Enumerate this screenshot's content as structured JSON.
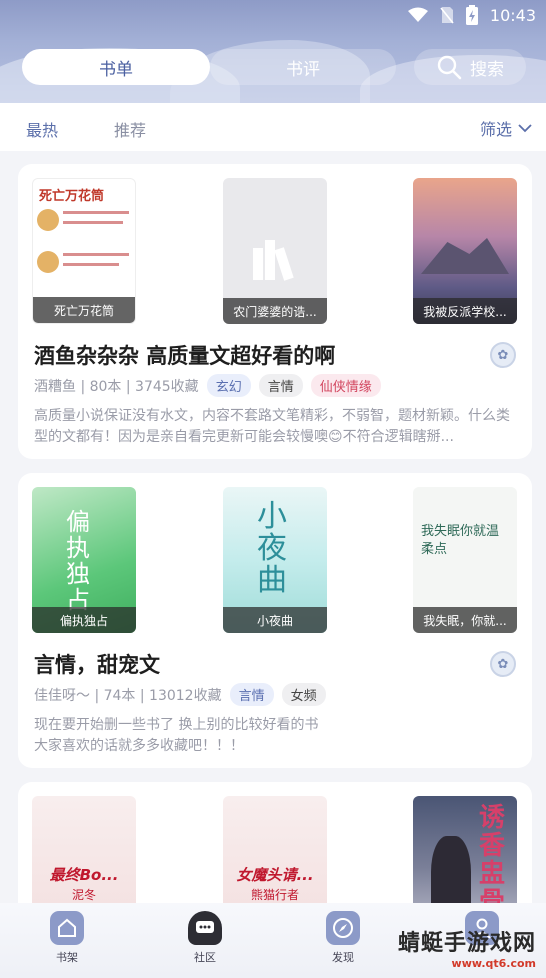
{
  "status": {
    "time": "10:43"
  },
  "top_tabs": [
    "书单",
    "书评"
  ],
  "search": {
    "label": "搜索"
  },
  "filter_tabs": {
    "active": "最热",
    "inactive": "推荐"
  },
  "filter": {
    "label": "筛选"
  },
  "cards": [
    {
      "covers": [
        {
          "caption": "死亡万花筒",
          "cover_text": "死亡万花筒"
        },
        {
          "caption": "农门婆婆的诰..."
        },
        {
          "caption": "我被反派学校..."
        }
      ],
      "title": "酒鱼杂杂杂 高质量文超好看的啊",
      "meta": "酒糟鱼 | 80本 | 3745收藏",
      "tags": [
        "玄幻",
        "言情",
        "仙侠情缘"
      ],
      "desc": "高质量小说保证没有水文，内容不套路文笔精彩，不弱智，题材新颖。什么类型的文都有！因为是亲自看完更新可能会较慢噢😊不符合逻辑瞎掰..."
    },
    {
      "covers": [
        {
          "caption": "偏执独占",
          "cover_text": "偏执独占"
        },
        {
          "caption": "小夜曲",
          "cover_text": "小夜曲"
        },
        {
          "caption": "我失眠，你就...",
          "cover_text": "我失眠你就温柔点"
        }
      ],
      "title": "言情，甜宠文",
      "meta": "佳佳呀～ | 74本 | 13012收藏",
      "tags": [
        "言情",
        "女频"
      ],
      "desc": "现在要开始删一些书了 换上别的比较好看的书\n大家喜欢的话就多多收藏吧！！！"
    },
    {
      "covers": [
        {
          "cover_text": "最终Bo...",
          "author": "泥冬"
        },
        {
          "cover_text": "女魔头请...",
          "author": "熊猫行者"
        },
        {
          "cover_text": "诱香盅骨"
        }
      ]
    }
  ],
  "bottom_nav": [
    "书架",
    "社区",
    "发现"
  ],
  "watermark": {
    "name": "蜻蜓手游戏网",
    "url": "www.qt6.com"
  }
}
